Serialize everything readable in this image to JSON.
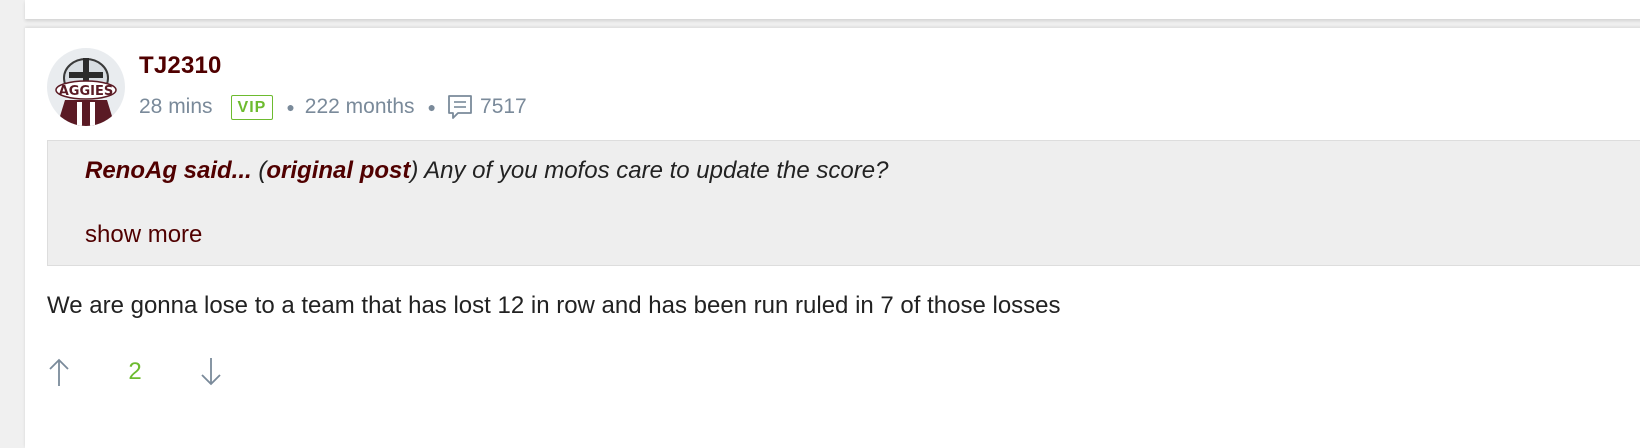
{
  "post": {
    "username": "TJ2310",
    "time_ago": "28 mins",
    "badge": "VIP",
    "member_duration": "222 months",
    "post_count": "7517",
    "quote": {
      "author": "RenoAg said...",
      "link_open": " (",
      "link_label": "original post",
      "link_close": ")",
      "text": " Any of you mofos care to update the score?",
      "show_more_label": "show more"
    },
    "body": "We are gonna lose to a team that has lost 12 in row and has been run ruled in 7 of those losses",
    "votes": {
      "score": "2"
    }
  },
  "icons": {
    "comment": "comment-bubble-icon",
    "upvote": "arrow-up-icon",
    "downvote": "arrow-down-icon"
  },
  "colors": {
    "brand_maroon": "#500000",
    "vip_green": "#6dbb2f",
    "meta_gray": "#7a8a9a",
    "quote_bg": "#eeeeee"
  }
}
